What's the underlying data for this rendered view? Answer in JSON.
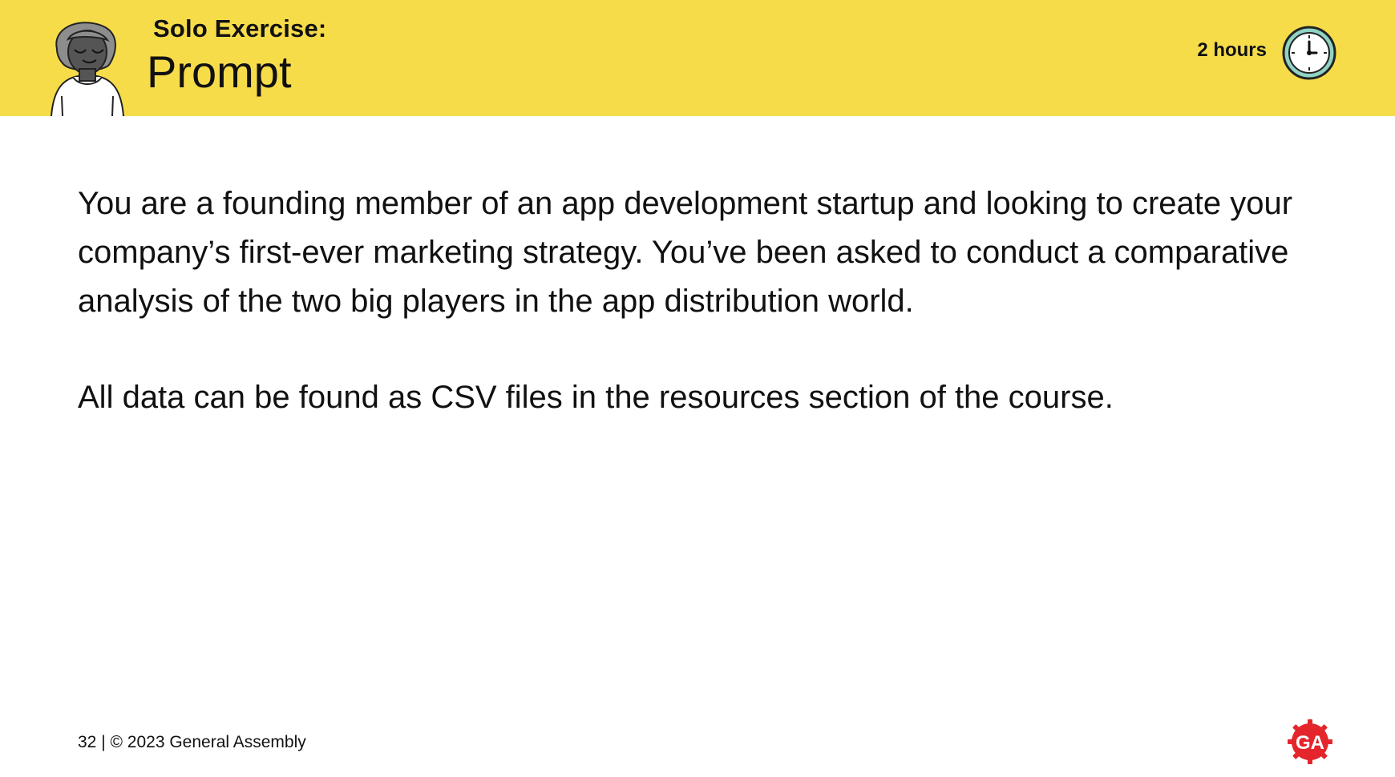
{
  "header": {
    "kicker": "Solo Exercise:",
    "title": "Prompt",
    "duration": "2 hours",
    "background_color": "#f7dc4a",
    "avatar_icon": "person-avatar-icon",
    "clock_icon": "clock-icon"
  },
  "body": {
    "paragraphs": [
      "You are a founding member of an app development startup and looking to create your company’s first-ever marketing strategy. You’ve been asked to conduct a comparative analysis of the two big players in the app distribution world.",
      "All data can be found as CSV files in the resources section of the course."
    ]
  },
  "footer": {
    "text": "32 | © 2023 General Assembly",
    "logo_icon": "general-assembly-logo-icon",
    "logo_color": "#e4252b",
    "logo_text": "GA"
  }
}
